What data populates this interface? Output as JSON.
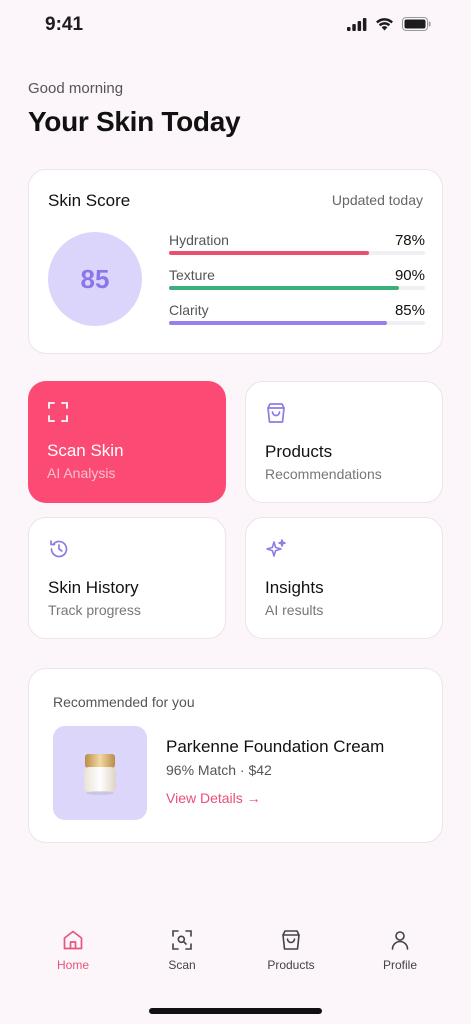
{
  "status": {
    "time": "9:41"
  },
  "greeting": "Good morning",
  "title": "Your Skin Today",
  "score_card": {
    "title": "Skin Score",
    "updated": "Updated today",
    "score": "85",
    "score_color": "#8b76e9",
    "metrics": [
      {
        "label": "Hydration",
        "value": "78%",
        "fraction": 0.78,
        "color": "#e9506e"
      },
      {
        "label": "Texture",
        "value": "90%",
        "fraction": 0.9,
        "color": "#3bb07d"
      },
      {
        "label": "Clarity",
        "value": "85%",
        "fraction": 0.85,
        "color": "#9a7ef0"
      }
    ]
  },
  "tiles": [
    {
      "title": "Scan Skin",
      "subtitle": "AI Analysis",
      "icon": "scan-frame-icon"
    },
    {
      "title": "Products",
      "subtitle": "Recommendations",
      "icon": "shopping-bag-icon"
    },
    {
      "title": "Skin History",
      "subtitle": "Track progress",
      "icon": "history-clock-icon"
    },
    {
      "title": "Insights",
      "subtitle": "AI results",
      "icon": "sparkle-icon"
    }
  ],
  "recommendation": {
    "heading": "Recommended for you",
    "name": "Parkenne Foundation Cream",
    "meta": "96% Match · $42",
    "link": "View Details →"
  },
  "nav": {
    "items": [
      {
        "label": "Home",
        "icon": "home-icon",
        "active": true
      },
      {
        "label": "Scan",
        "icon": "scan-icon",
        "active": false
      },
      {
        "label": "Products",
        "icon": "shopping-bag-icon",
        "active": false
      },
      {
        "label": "Profile",
        "icon": "user-icon",
        "active": false
      }
    ],
    "active_color": "#e8557b",
    "accent": "#fb4a74"
  }
}
